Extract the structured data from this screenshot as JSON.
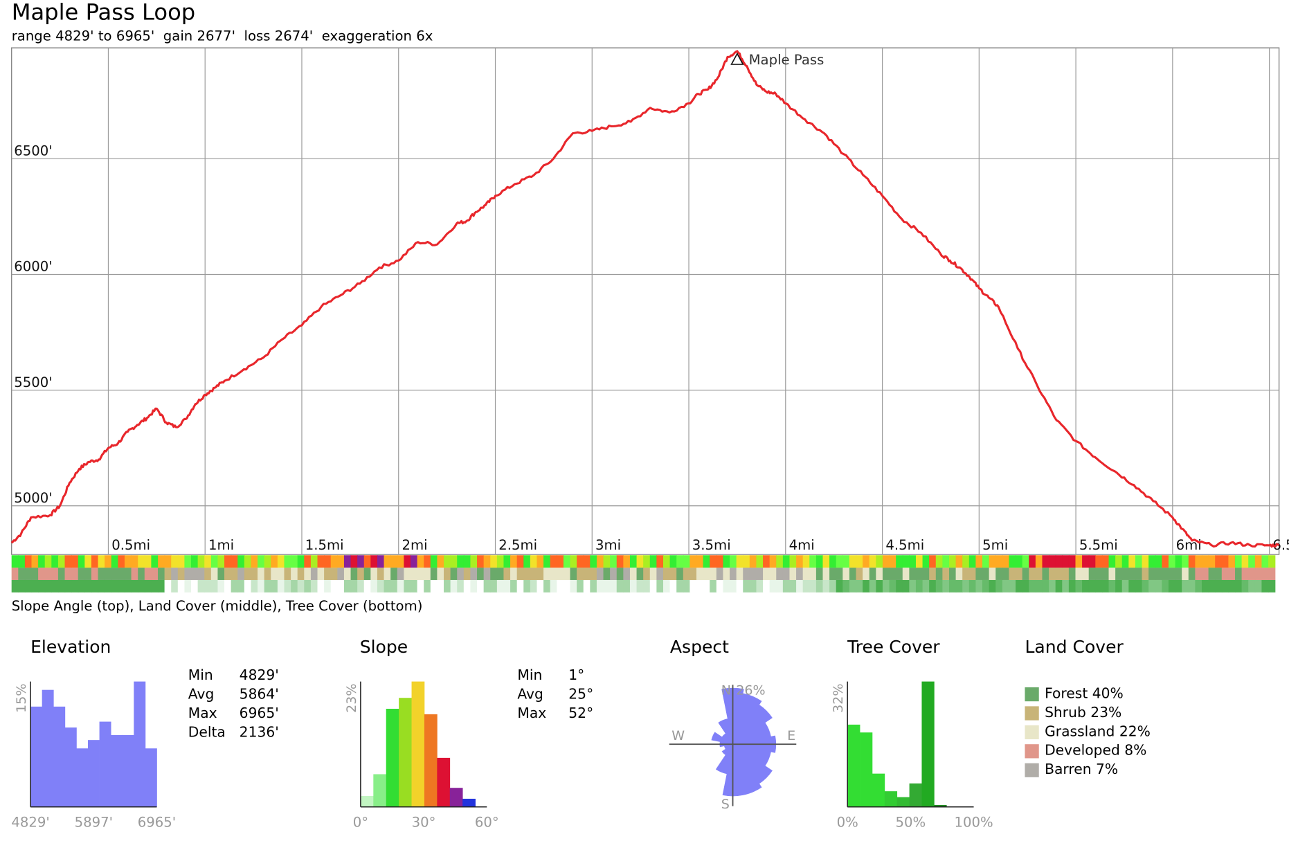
{
  "header": {
    "title": "Maple Pass Loop",
    "subtitle": "range 4829' to 6965'  gain 2677'  loss 2674'  exaggeration 6x"
  },
  "profile": {
    "y_tick_labels": [
      "5000'",
      "5500'",
      "6000'",
      "6500'"
    ],
    "x_tick_labels": [
      "0.5mi",
      "1mi",
      "1.5mi",
      "2mi",
      "2.5mi",
      "3mi",
      "3.5mi",
      "4mi",
      "4.5mi",
      "5mi",
      "5.5mi",
      "6mi",
      "6.5mi"
    ],
    "peak_label": "Maple Pass",
    "strip_caption": "Slope Angle (top), Land Cover (middle), Tree Cover (bottom)"
  },
  "colors": {
    "profile_line": "#e8262b",
    "histogram_blue": "#8080f8",
    "forest": "#6aaa6a",
    "shrub": "#c8b478",
    "grassland": "#e8e6c8",
    "developed": "#e0968a",
    "barren": "#b0ada8"
  },
  "chart_data": [
    {
      "type": "line",
      "title": "Maple Pass Loop",
      "xlabel": "",
      "ylabel": "",
      "x_unit": "mi",
      "y_unit": "ft",
      "xlim": [
        0,
        6.55
      ],
      "ylim": [
        4829,
        6965
      ],
      "grid": true,
      "x_ticks": [
        0.5,
        1,
        1.5,
        2,
        2.5,
        3,
        3.5,
        4,
        4.5,
        5,
        5.5,
        6,
        6.5
      ],
      "y_ticks": [
        5000,
        5500,
        6000,
        6500
      ],
      "annotation": {
        "x": 3.75,
        "y": 6965,
        "label": "Maple Pass"
      },
      "x": [
        0,
        0.05,
        0.1,
        0.2,
        0.25,
        0.3,
        0.35,
        0.4,
        0.45,
        0.5,
        0.55,
        0.6,
        0.65,
        0.7,
        0.75,
        0.8,
        0.85,
        0.9,
        0.95,
        1.0,
        1.05,
        1.1,
        1.2,
        1.3,
        1.4,
        1.5,
        1.6,
        1.7,
        1.8,
        1.9,
        2.0,
        2.1,
        2.2,
        2.3,
        2.35,
        2.4,
        2.45,
        2.5,
        2.6,
        2.7,
        2.8,
        2.9,
        3.0,
        3.1,
        3.2,
        3.3,
        3.4,
        3.5,
        3.55,
        3.6,
        3.65,
        3.7,
        3.75,
        3.8,
        3.85,
        3.9,
        3.95,
        4.0,
        4.1,
        4.2,
        4.3,
        4.4,
        4.5,
        4.6,
        4.7,
        4.8,
        4.85,
        4.9,
        4.95,
        5.0,
        5.05,
        5.1,
        5.2,
        5.3,
        5.4,
        5.5,
        5.6,
        5.7,
        5.8,
        5.9,
        6.0,
        6.05,
        6.1,
        6.2,
        6.3,
        6.4,
        6.5,
        6.55
      ],
      "y": [
        4840,
        4880,
        4950,
        4960,
        5000,
        5100,
        5160,
        5190,
        5200,
        5250,
        5270,
        5320,
        5350,
        5380,
        5420,
        5360,
        5340,
        5375,
        5440,
        5480,
        5510,
        5540,
        5590,
        5640,
        5720,
        5780,
        5860,
        5910,
        5960,
        6030,
        6060,
        6140,
        6130,
        6220,
        6230,
        6270,
        6300,
        6340,
        6390,
        6430,
        6500,
        6610,
        6620,
        6640,
        6660,
        6720,
        6700,
        6740,
        6780,
        6800,
        6850,
        6940,
        6965,
        6900,
        6820,
        6790,
        6780,
        6740,
        6670,
        6610,
        6520,
        6430,
        6340,
        6240,
        6180,
        6090,
        6060,
        6030,
        5990,
        5940,
        5900,
        5860,
        5680,
        5520,
        5370,
        5280,
        5210,
        5150,
        5090,
        5020,
        4950,
        4900,
        4850,
        4830,
        4840,
        4830,
        4829,
        4830
      ]
    },
    {
      "type": "bar",
      "title": "Elevation",
      "x_tick_labels": [
        "4829'",
        "5897'",
        "6965'"
      ],
      "ylim_label": "15%",
      "ylim": [
        0,
        15
      ],
      "values": [
        12,
        14,
        12,
        9.5,
        7,
        8,
        10.2,
        8.6,
        8.6,
        15,
        7
      ],
      "stats": {
        "labels": [
          "Min",
          "Avg",
          "Max",
          "Delta"
        ],
        "values": [
          "4829'",
          "5864'",
          "6965'",
          "2136'"
        ]
      }
    },
    {
      "type": "bar",
      "title": "Slope",
      "x_tick_labels": [
        "0°",
        "30°",
        "60°"
      ],
      "ylim_label": "23%",
      "ylim": [
        0,
        23
      ],
      "bin_width_deg": 5,
      "values": [
        2,
        6,
        18,
        20,
        23,
        17,
        9,
        3.5,
        1.5
      ],
      "bin_colors": [
        "#c2f5c2",
        "#88ee88",
        "#33dd33",
        "#99dd22",
        "#f2d22a",
        "#ee7722",
        "#dd1133",
        "#882299",
        "#2233dd"
      ],
      "stats": {
        "labels": [
          "Min",
          "Avg",
          "Max"
        ],
        "values": [
          "1°",
          "25°",
          "52°"
        ]
      }
    },
    {
      "type": "polar",
      "title": "Aspect",
      "direction_labels": [
        "N",
        "E",
        "S",
        "W"
      ],
      "max_label": "26%",
      "sectors": [
        "N",
        "NNE",
        "NE",
        "ENE",
        "E",
        "ESE",
        "SE",
        "SSE",
        "S",
        "SSW",
        "SW",
        "WSW",
        "W",
        "WNW",
        "NW",
        "NNW"
      ],
      "values": [
        26,
        24,
        22,
        18,
        20,
        18,
        22,
        24,
        24,
        14,
        6,
        4,
        6,
        10,
        6,
        12
      ]
    },
    {
      "type": "bar",
      "title": "Tree Cover",
      "x_tick_labels": [
        "0%",
        "50%",
        "100%"
      ],
      "ylim_label": "32%",
      "ylim": [
        0,
        32
      ],
      "bin_width_pct": 10,
      "values": [
        21,
        19,
        8.5,
        4,
        2.5,
        6,
        32,
        0.5,
        0,
        0
      ],
      "bin_colors": [
        "#33dd33",
        "#33dd33",
        "#33dd33",
        "#33cc33",
        "#33bb33",
        "#33aa33",
        "#22aa22",
        "#228822",
        "#227722",
        "#226622"
      ]
    }
  ],
  "land_cover": {
    "title": "Land Cover",
    "items": [
      {
        "label": "Forest 40%",
        "color": "#6aaa6a"
      },
      {
        "label": "Shrub 23%",
        "color": "#c8b478"
      },
      {
        "label": "Grassland 22%",
        "color": "#e8e6c8"
      },
      {
        "label": "Developed 8%",
        "color": "#e0968a"
      },
      {
        "label": "Barren 7%",
        "color": "#b0ada8"
      }
    ]
  }
}
